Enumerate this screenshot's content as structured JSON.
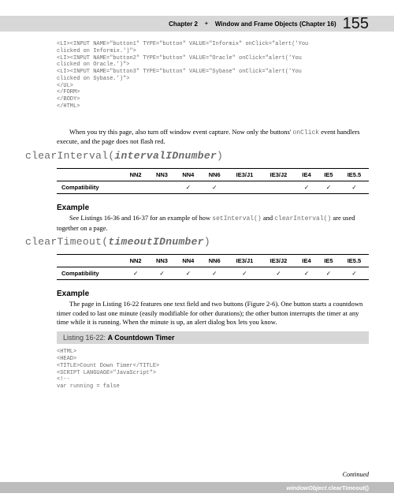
{
  "header": {
    "chapter": "Chapter 2",
    "diamond": "✦",
    "title": "Window and Frame Objects (Chapter 16)",
    "page": "155"
  },
  "code1": "<LI><INPUT NAME=\"button1\" TYPE=\"button\" VALUE=\"Informix\" onClick=\"alert('You\nclicked on Informix.')\">\n<LI><INPUT NAME=\"button2\" TYPE=\"button\" VALUE=\"Oracle\" onClick=\"alert('You\nclicked on Oracle.')\">\n<LI><INPUT NAME=\"button3\" TYPE=\"button\" VALUE=\"Sybase\" onClick=\"alert('You\nclicked on Sybase.')\">\n</UL>\n</FORM>\n</BODY>\n</HTML>",
  "para1a": "When you try this page, also turn off window event capture. Now only the buttons' ",
  "para1b": "onClick",
  "para1c": " event handlers execute, and the page does not flash red.",
  "sig1": {
    "fn": "clearInterval(",
    "arg": "intervalIDnumber",
    "close": ")"
  },
  "compat_cols": [
    "",
    "NN2",
    "NN3",
    "NN4",
    "NN6",
    "IE3/J1",
    "IE3/J2",
    "IE4",
    "IE5",
    "IE5.5"
  ],
  "compat_row1": [
    "Compatibility",
    "",
    "",
    "✓",
    "✓",
    "",
    "",
    "✓",
    "✓",
    "✓"
  ],
  "example_h": "Example",
  "para2a": "See Listings 16-36 and 16-37 for an example of how ",
  "para2b": "setInterval()",
  "para2c": " and ",
  "para2d": "clearInterval()",
  "para2e": " are used together on a page.",
  "sig2": {
    "fn": "clearTimeout(",
    "arg": "timeoutIDnumber",
    "close": ")"
  },
  "compat_row2": [
    "Compatibility",
    "✓",
    "✓",
    "✓",
    "✓",
    "✓",
    "✓",
    "✓",
    "✓",
    "✓"
  ],
  "para3": "The page in Listing 16-22 features one text field and two buttons (Figure 2-6). One button starts a countdown timer coded to last one minute (easily modifiable for other durations); the other button interrupts the timer at any time while it is running. When the minute is up, an alert dialog box lets you know.",
  "listing": {
    "label": "Listing 16-22:",
    "title": "A Countdown Timer"
  },
  "code2": "<HTML>\n<HEAD>\n<TITLE>Count Down Timer</TITLE>\n<SCRIPT LANGUAGE=\"JavaScript\">\n<!--\nvar running = false",
  "continued": "Continued",
  "footer": {
    "obj": "windowObject",
    "dot": ".",
    "meth": "clearTimeout()"
  }
}
